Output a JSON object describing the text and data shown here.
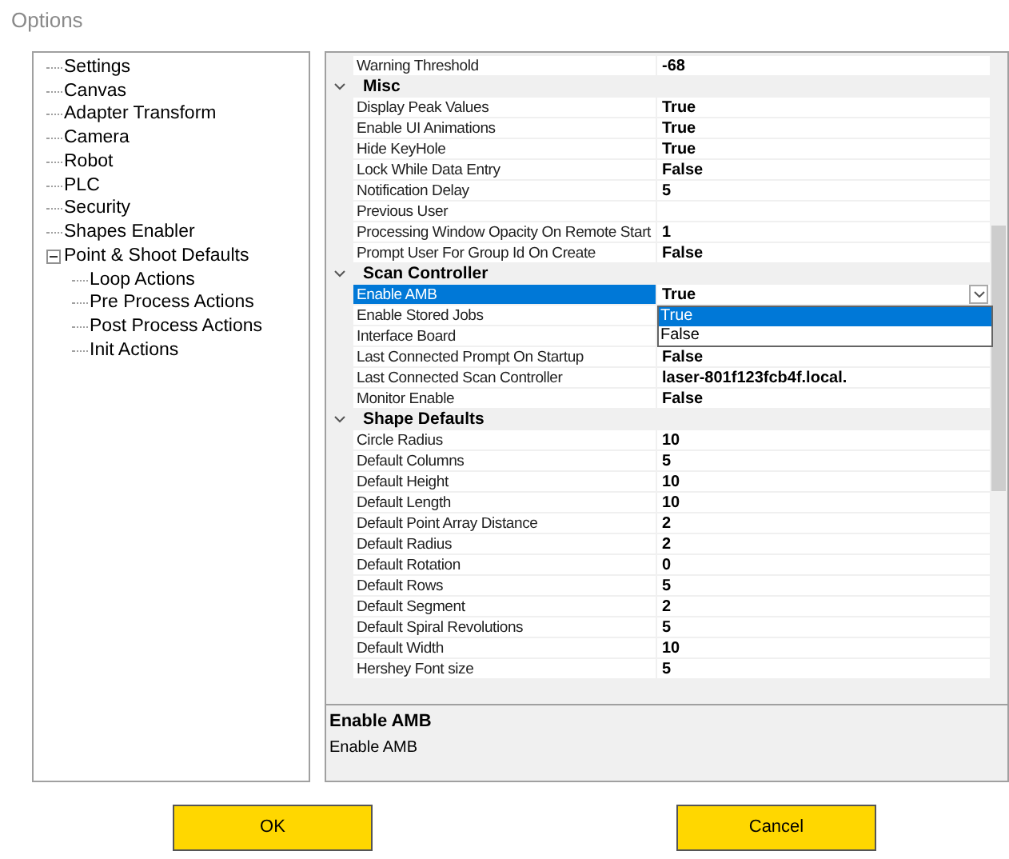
{
  "window": {
    "title": "Options"
  },
  "tree": [
    {
      "label": "Settings"
    },
    {
      "label": "Canvas"
    },
    {
      "label": "Adapter Transform"
    },
    {
      "label": "Camera"
    },
    {
      "label": "Robot"
    },
    {
      "label": "PLC"
    },
    {
      "label": "Security"
    },
    {
      "label": "Shapes Enabler"
    },
    {
      "label": "Point & Shoot Defaults",
      "expanded": true,
      "children": [
        {
          "label": "Loop Actions"
        },
        {
          "label": "Pre Process Actions"
        },
        {
          "label": "Post Process Actions"
        },
        {
          "label": "Init Actions"
        }
      ]
    }
  ],
  "grid": {
    "rows": [
      {
        "kind": "property",
        "label": "Warning Threshold",
        "value": "-68",
        "selected": false
      },
      {
        "kind": "category",
        "label": "Misc",
        "expanded": true
      },
      {
        "kind": "property",
        "label": "Display Peak Values",
        "value": "True",
        "selected": false
      },
      {
        "kind": "property",
        "label": "Enable UI Animations",
        "value": "True",
        "selected": false
      },
      {
        "kind": "property",
        "label": "Hide KeyHole",
        "value": "True",
        "selected": false
      },
      {
        "kind": "property",
        "label": "Lock While Data Entry",
        "value": "False",
        "selected": false
      },
      {
        "kind": "property",
        "label": "Notification Delay",
        "value": "5",
        "selected": false
      },
      {
        "kind": "property",
        "label": "Previous User",
        "selected": false
      },
      {
        "kind": "property",
        "label": "Processing Window Opacity On Remote Start",
        "value": "1",
        "selected": false
      },
      {
        "kind": "property",
        "label": "Prompt User For Group Id On Create",
        "value": "False",
        "selected": false
      },
      {
        "kind": "category",
        "label": "Scan Controller",
        "expanded": true
      },
      {
        "kind": "property",
        "label": "Enable AMB",
        "value": "True",
        "selected": true
      },
      {
        "kind": "property",
        "label": "Enable Stored Jobs",
        "selected": false
      },
      {
        "kind": "property",
        "label": "Interface Board",
        "selected": false
      },
      {
        "kind": "property",
        "label": "Last Connected Prompt On Startup",
        "value": "False",
        "selected": false
      },
      {
        "kind": "property",
        "label": "Last Connected Scan Controller",
        "value": "laser-801f123fcb4f.local.",
        "selected": false
      },
      {
        "kind": "property",
        "label": "Monitor Enable",
        "value": "False",
        "selected": false
      },
      {
        "kind": "category",
        "label": "Shape Defaults",
        "expanded": true
      },
      {
        "kind": "property",
        "label": "Circle Radius",
        "value": "10",
        "selected": false
      },
      {
        "kind": "property",
        "label": "Default Columns",
        "value": "5",
        "selected": false
      },
      {
        "kind": "property",
        "label": "Default Height",
        "value": "10",
        "selected": false
      },
      {
        "kind": "property",
        "label": "Default Length",
        "value": "10",
        "selected": false
      },
      {
        "kind": "property",
        "label": "Default Point Array Distance",
        "value": "2",
        "selected": false
      },
      {
        "kind": "property",
        "label": "Default Radius",
        "value": "2",
        "selected": false
      },
      {
        "kind": "property",
        "label": "Default Rotation",
        "value": "0",
        "selected": false
      },
      {
        "kind": "property",
        "label": "Default Rows",
        "value": "5",
        "selected": false
      },
      {
        "kind": "property",
        "label": "Default Segment",
        "value": "2",
        "selected": false
      },
      {
        "kind": "property",
        "label": "Default Spiral Revolutions",
        "value": "5",
        "selected": false
      },
      {
        "kind": "property",
        "label": "Default Width",
        "value": "10",
        "selected": false
      },
      {
        "kind": "property",
        "label": "Hershey Font size",
        "value": "5",
        "selected": false
      }
    ],
    "dropdown": {
      "options": [
        {
          "label": "True",
          "selected": true
        },
        {
          "label": "False",
          "selected": false
        }
      ]
    },
    "description": {
      "title": "Enable AMB",
      "text": "Enable AMB"
    }
  },
  "buttons": [
    {
      "label": "OK"
    },
    {
      "label": "Cancel"
    }
  ]
}
